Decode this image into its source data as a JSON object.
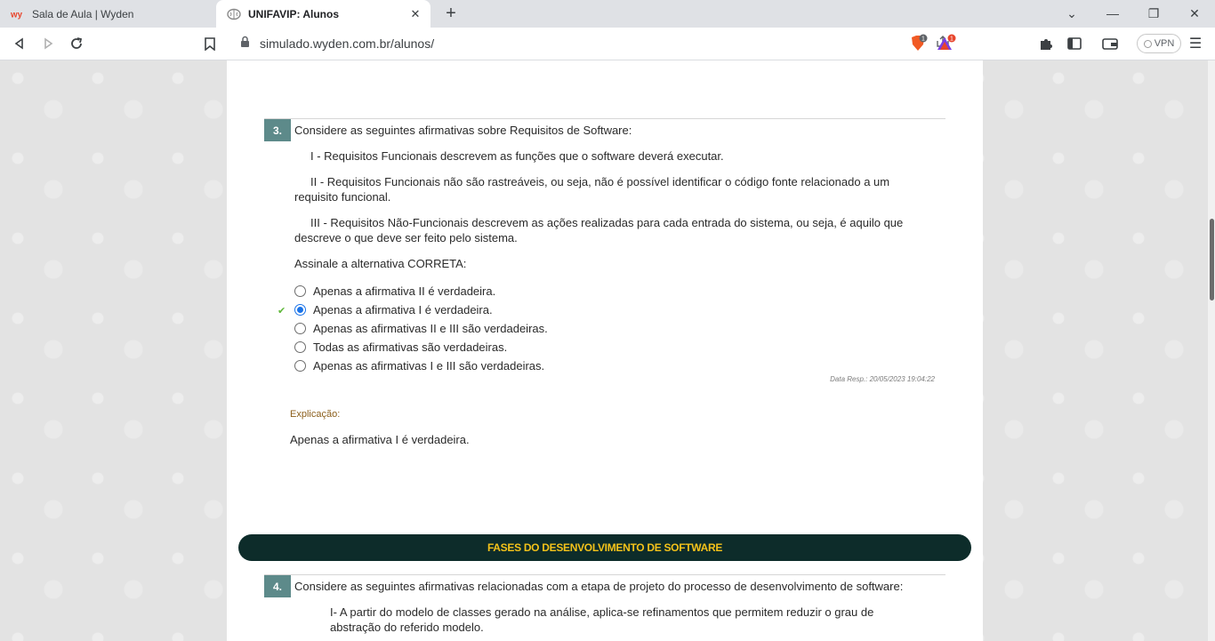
{
  "browser": {
    "tabs": [
      {
        "title": "Sala de Aula | Wyden",
        "favicon": "wyden-logo-icon",
        "active": false
      },
      {
        "title": "UNIFAVIP: Alunos",
        "favicon": "brain-icon",
        "active": true
      }
    ],
    "url": "simulado.wyden.com.br/alunos/",
    "vpn_label": "VPN",
    "brave_badge": "1",
    "rewards_badge": "1"
  },
  "question3": {
    "number": "3.",
    "prompt": "Considere as seguintes afirmativas sobre Requisitos de Software:",
    "statements": [
      "I - Requisitos Funcionais descrevem as funções que o software deverá executar.",
      "II - Requisitos Funcionais não são rastreáveis, ou seja, não é possível identificar o código fonte relacionado a um",
      "requisito funcional.",
      "III - Requisitos Não-Funcionais descrevem as ações realizadas para cada entrada do sistema, ou seja, é aquilo que",
      "descreve o que deve ser feito pelo sistema."
    ],
    "instruction": "Assinale a alternativa CORRETA:",
    "options": [
      "Apenas a afirmativa II é verdadeira.",
      "Apenas a afirmativa I é verdadeira.",
      "Apenas as afirmativas II e III são verdadeiras.",
      "Todas as afirmativas são verdadeiras.",
      "Apenas as afirmativas I e III são verdadeiras."
    ],
    "selected_index": 1,
    "correct_mark": "✔",
    "response_date": "Data Resp.: 20/05/2023 19:04:22",
    "explanation_label": "Explicação:",
    "explanation_text": "Apenas a afirmativa I é verdadeira."
  },
  "section_banner": "FASES DO DESENVOLVIMENTO DE SOFTWARE",
  "question4": {
    "number": "4.",
    "prompt": "Considere as seguintes afirmativas relacionadas com a etapa de projeto do processo de desenvolvimento de software:",
    "statements": [
      "I- A partir do modelo de classes gerado na análise, aplica-se refinamentos que permitem reduzir o grau de",
      "abstração do referido modelo."
    ]
  },
  "colors": {
    "question_badge": "#5d8a8a",
    "banner_bg": "#0d2c2a",
    "banner_text": "#f4c21a",
    "radio_selected": "#1a73e8",
    "check": "#5fb83a",
    "explanation_label": "#8b5e1a"
  }
}
